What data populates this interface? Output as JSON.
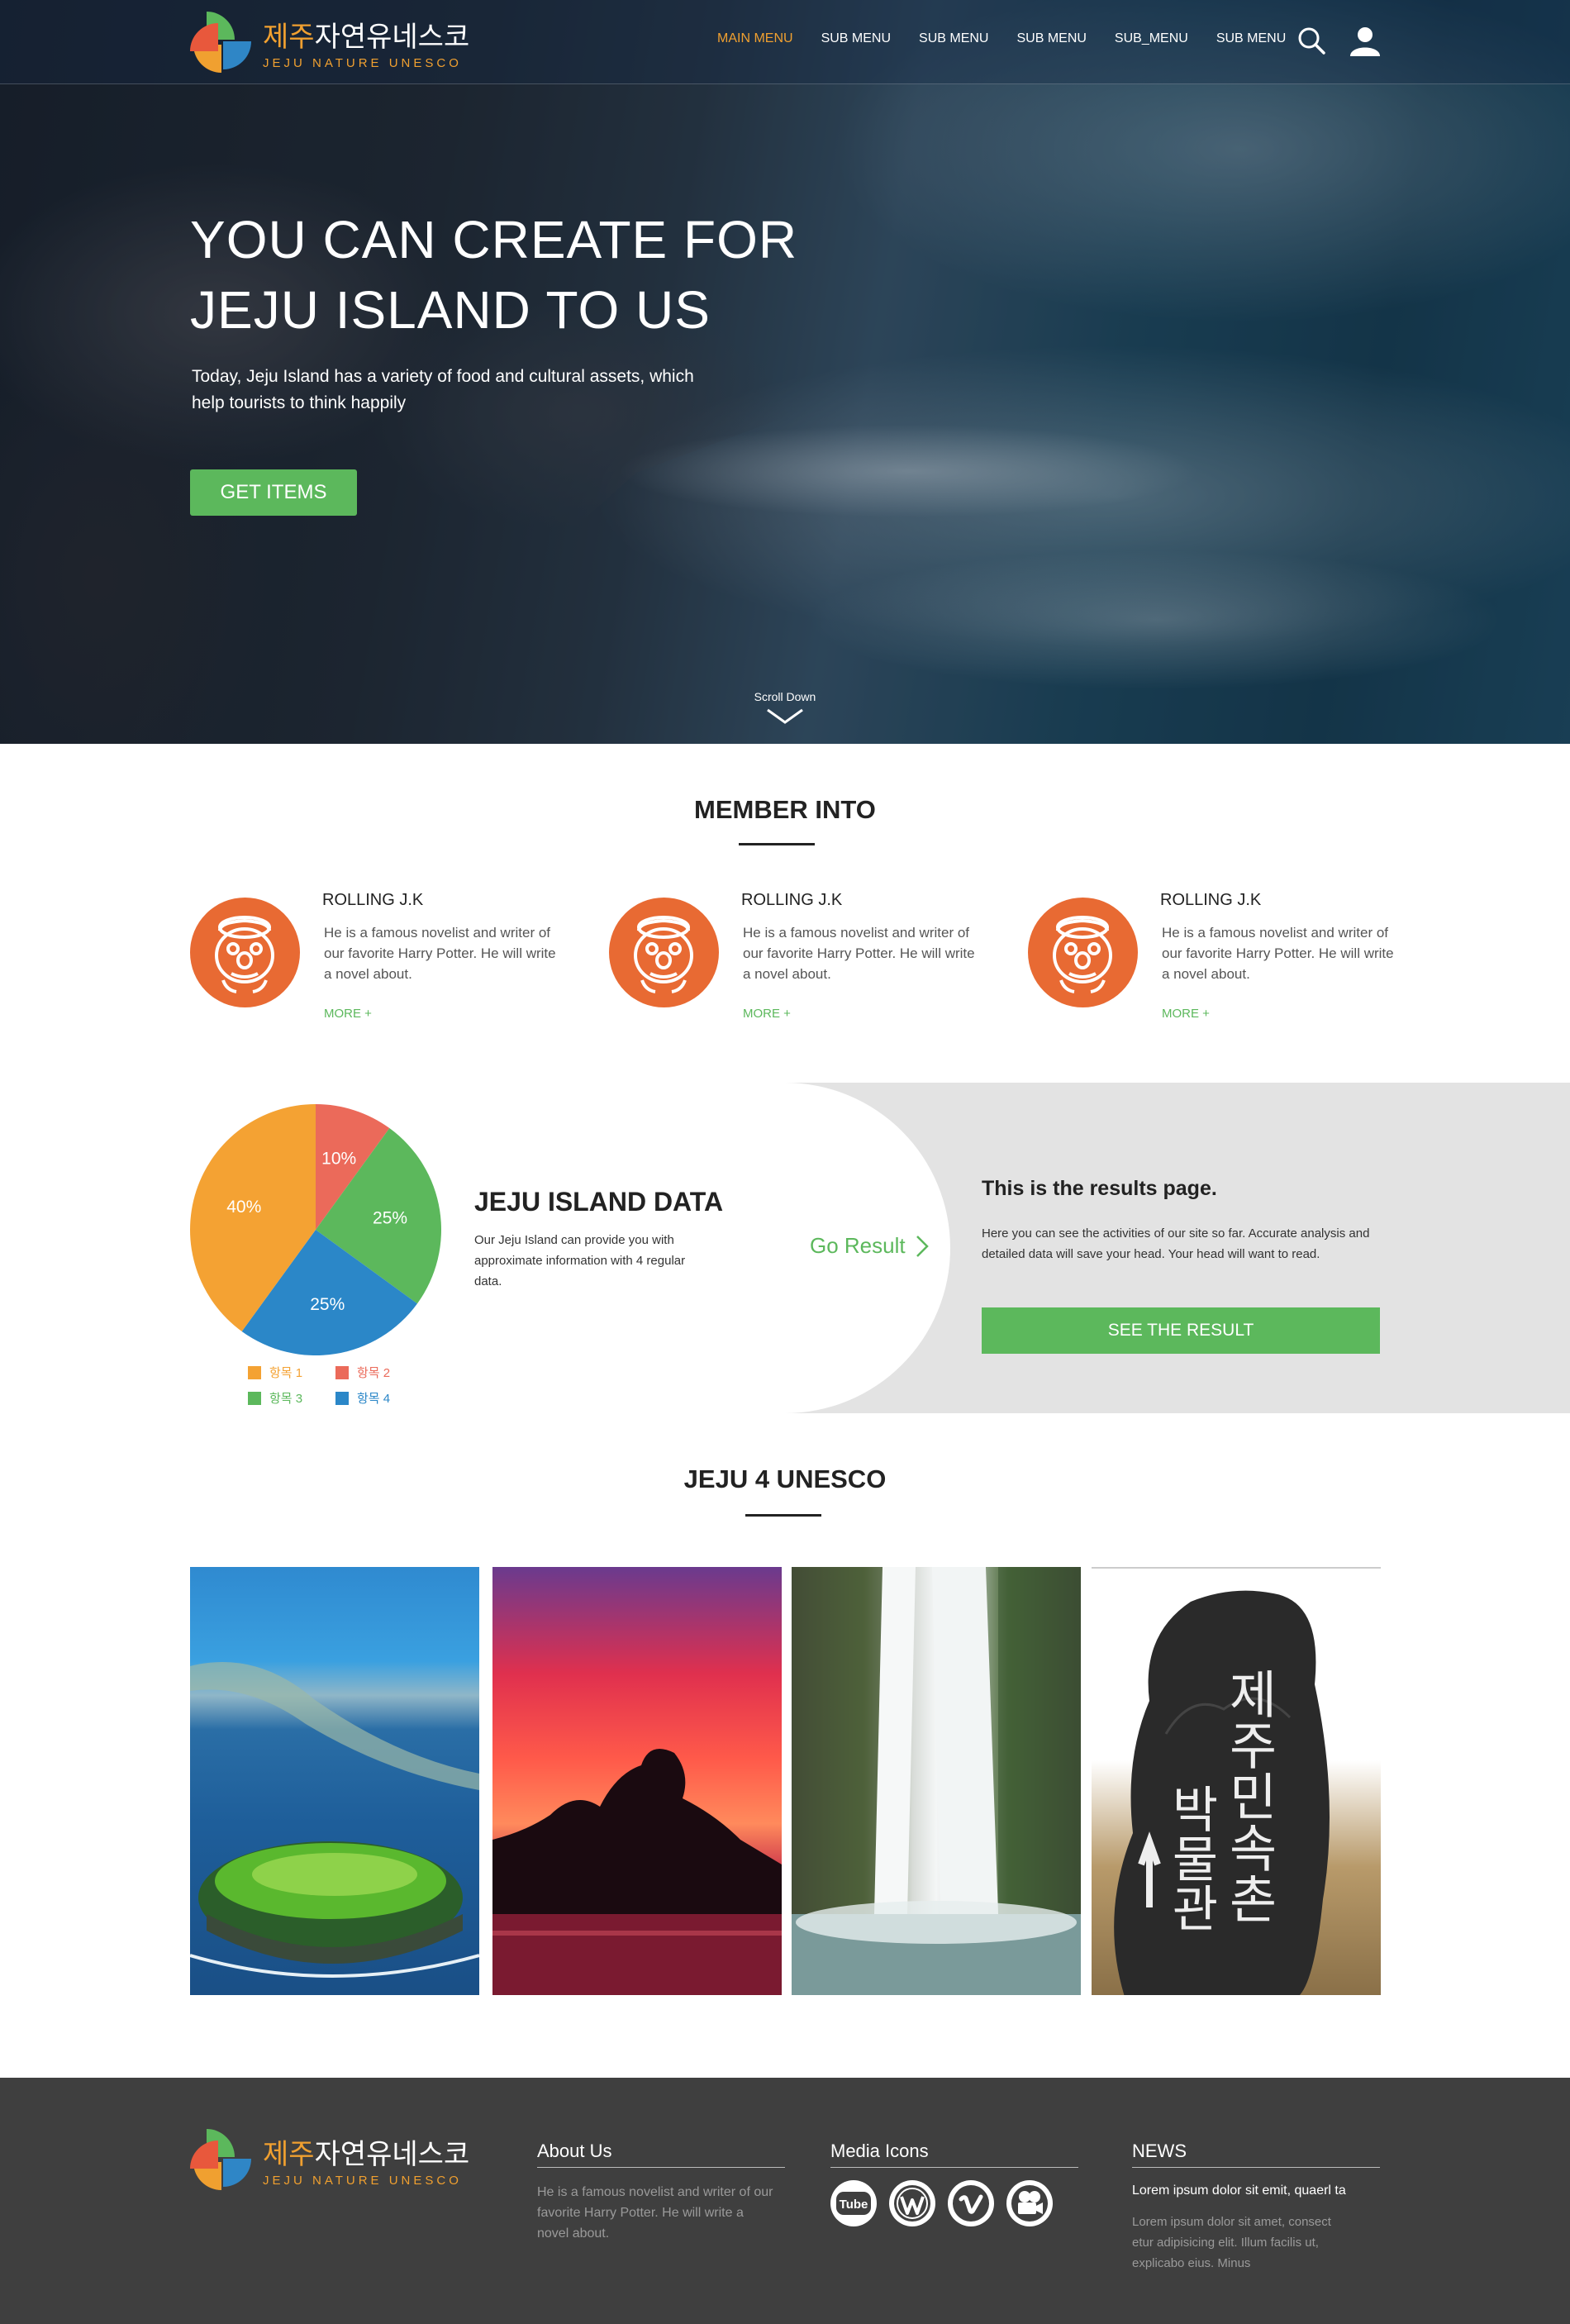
{
  "brand": {
    "name_ko_highlight": "제주",
    "name_ko_rest": "자연유네스코",
    "name_en": "JEJU NATURE UNESCO"
  },
  "nav": {
    "items": [
      {
        "label": "MAIN MENU",
        "active": true
      },
      {
        "label": "SUB MENU",
        "active": false
      },
      {
        "label": "SUB MENU",
        "active": false
      },
      {
        "label": "SUB MENU",
        "active": false
      },
      {
        "label": "SUB_MENU",
        "active": false
      },
      {
        "label": "SUB MENU",
        "active": false
      }
    ],
    "icons": [
      "search-icon",
      "user-icon"
    ]
  },
  "hero": {
    "title": "YOU CAN CREATE FOR\nJEJU ISLAND TO US",
    "subtitle": "Today, Jeju Island has a variety of food and cultural assets, which help tourists to think happily",
    "button": "GET ITEMS",
    "scroll": "Scroll Down"
  },
  "members_section": {
    "title": "MEMBER INTO",
    "members": [
      {
        "name": "ROLLING J.K",
        "desc": "He is a famous novelist and writer of our favorite Harry Potter. He will write a novel about.",
        "more": "MORE +"
      },
      {
        "name": "ROLLING J.K",
        "desc": "He is a famous novelist and writer of our favorite Harry Potter. He will write a novel about.",
        "more": "MORE +"
      },
      {
        "name": "ROLLING J.K",
        "desc": "He is a famous novelist and writer of our favorite Harry Potter. He will write a novel about.",
        "more": "MORE +"
      }
    ]
  },
  "data_section": {
    "title": "JEJU ISLAND DATA",
    "desc": "Our Jeju Island can provide you with approximate information with 4 regular data.",
    "go_result": "Go Result",
    "result_title": "This is the results page.",
    "result_desc": "Here you can see the activities of our site so far. Accurate analysis and detailed data will save your head. Your head will want to read.",
    "result_button": "SEE THE RESULT"
  },
  "chart_data": {
    "type": "pie",
    "categories": [
      "항목 1",
      "항목 2",
      "항목 3",
      "항목 4"
    ],
    "values": [
      40,
      10,
      25,
      25
    ],
    "labels": [
      "40%",
      "10%",
      "25%",
      "25%"
    ],
    "colors": [
      "#f4a233",
      "#eb6a5a",
      "#5cb85c",
      "#2b87c8"
    ],
    "legend": "bottom"
  },
  "unesco": {
    "title": "JEJU 4 UNESCO",
    "stone_text_left": "박물관",
    "stone_text_right": "제주민속촌"
  },
  "footer": {
    "about_title": "About Us",
    "about_text": "He is a famous novelist and writer of our favorite Harry Potter. He will write a novel about.",
    "media_title": "Media Icons",
    "media_icons": [
      "youtube-icon",
      "wordpress-icon",
      "vimeo-icon",
      "video-camera-icon"
    ],
    "youtube_label": "Tube",
    "news_title": "NEWS",
    "news_headline": "Lorem ipsum dolor sit emit, quaerl ta",
    "news_text": "Lorem ipsum dolor sit amet, consect etur adipisicing elit. Illum facilis ut, explicabo eius. Minus"
  },
  "colors": {
    "accent_green": "#5cb85c",
    "accent_orange": "#f0a030",
    "avatar_orange": "#e86a33",
    "footer_bg": "#3f3f3f"
  }
}
